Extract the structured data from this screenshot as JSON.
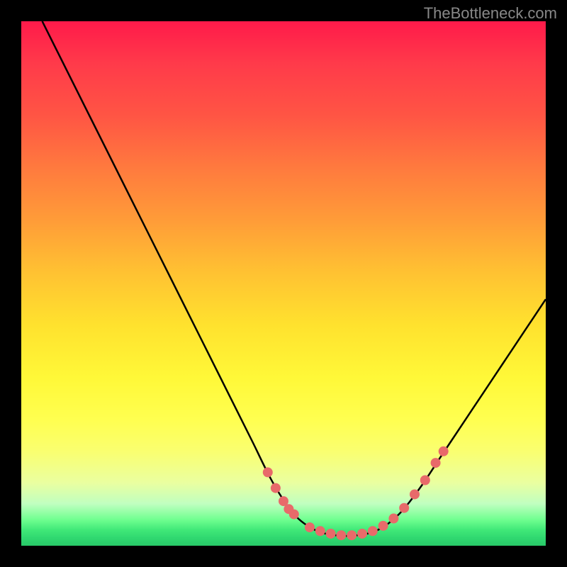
{
  "watermark": "TheBottleneck.com",
  "chart_data": {
    "type": "line",
    "title": "",
    "xlabel": "",
    "ylabel": "",
    "xlim": [
      0,
      100
    ],
    "ylim": [
      0,
      100
    ],
    "curve": {
      "name": "bottleneck-curve",
      "color": "#000000",
      "points": [
        {
          "x": 4,
          "y": 100
        },
        {
          "x": 8,
          "y": 92
        },
        {
          "x": 12,
          "y": 84
        },
        {
          "x": 16,
          "y": 76
        },
        {
          "x": 20,
          "y": 68
        },
        {
          "x": 24,
          "y": 60
        },
        {
          "x": 28,
          "y": 52
        },
        {
          "x": 32,
          "y": 44
        },
        {
          "x": 36,
          "y": 36
        },
        {
          "x": 40,
          "y": 28
        },
        {
          "x": 44,
          "y": 20
        },
        {
          "x": 48,
          "y": 12
        },
        {
          "x": 52,
          "y": 6
        },
        {
          "x": 56,
          "y": 3
        },
        {
          "x": 60,
          "y": 2
        },
        {
          "x": 64,
          "y": 2
        },
        {
          "x": 68,
          "y": 3
        },
        {
          "x": 72,
          "y": 6
        },
        {
          "x": 76,
          "y": 11
        },
        {
          "x": 80,
          "y": 17
        },
        {
          "x": 84,
          "y": 23
        },
        {
          "x": 88,
          "y": 29
        },
        {
          "x": 92,
          "y": 35
        },
        {
          "x": 96,
          "y": 41
        },
        {
          "x": 100,
          "y": 47
        }
      ]
    },
    "markers": {
      "color": "#e86a6a",
      "radius": 7,
      "points": [
        {
          "x": 47,
          "y": 14
        },
        {
          "x": 48.5,
          "y": 11
        },
        {
          "x": 50,
          "y": 8.5
        },
        {
          "x": 51,
          "y": 7
        },
        {
          "x": 52,
          "y": 6
        },
        {
          "x": 55,
          "y": 3.5
        },
        {
          "x": 57,
          "y": 2.8
        },
        {
          "x": 59,
          "y": 2.3
        },
        {
          "x": 61,
          "y": 2
        },
        {
          "x": 63,
          "y": 2
        },
        {
          "x": 65,
          "y": 2.3
        },
        {
          "x": 67,
          "y": 2.8
        },
        {
          "x": 69,
          "y": 3.8
        },
        {
          "x": 71,
          "y": 5.2
        },
        {
          "x": 73,
          "y": 7.2
        },
        {
          "x": 75,
          "y": 9.8
        },
        {
          "x": 77,
          "y": 12.5
        },
        {
          "x": 79,
          "y": 15.8
        },
        {
          "x": 80.5,
          "y": 18
        }
      ]
    },
    "gradient_bands": [
      {
        "stop": 0,
        "color": "#ff1a4a"
      },
      {
        "stop": 50,
        "color": "#ffd030"
      },
      {
        "stop": 80,
        "color": "#ffff60"
      },
      {
        "stop": 100,
        "color": "#28c868"
      }
    ]
  }
}
